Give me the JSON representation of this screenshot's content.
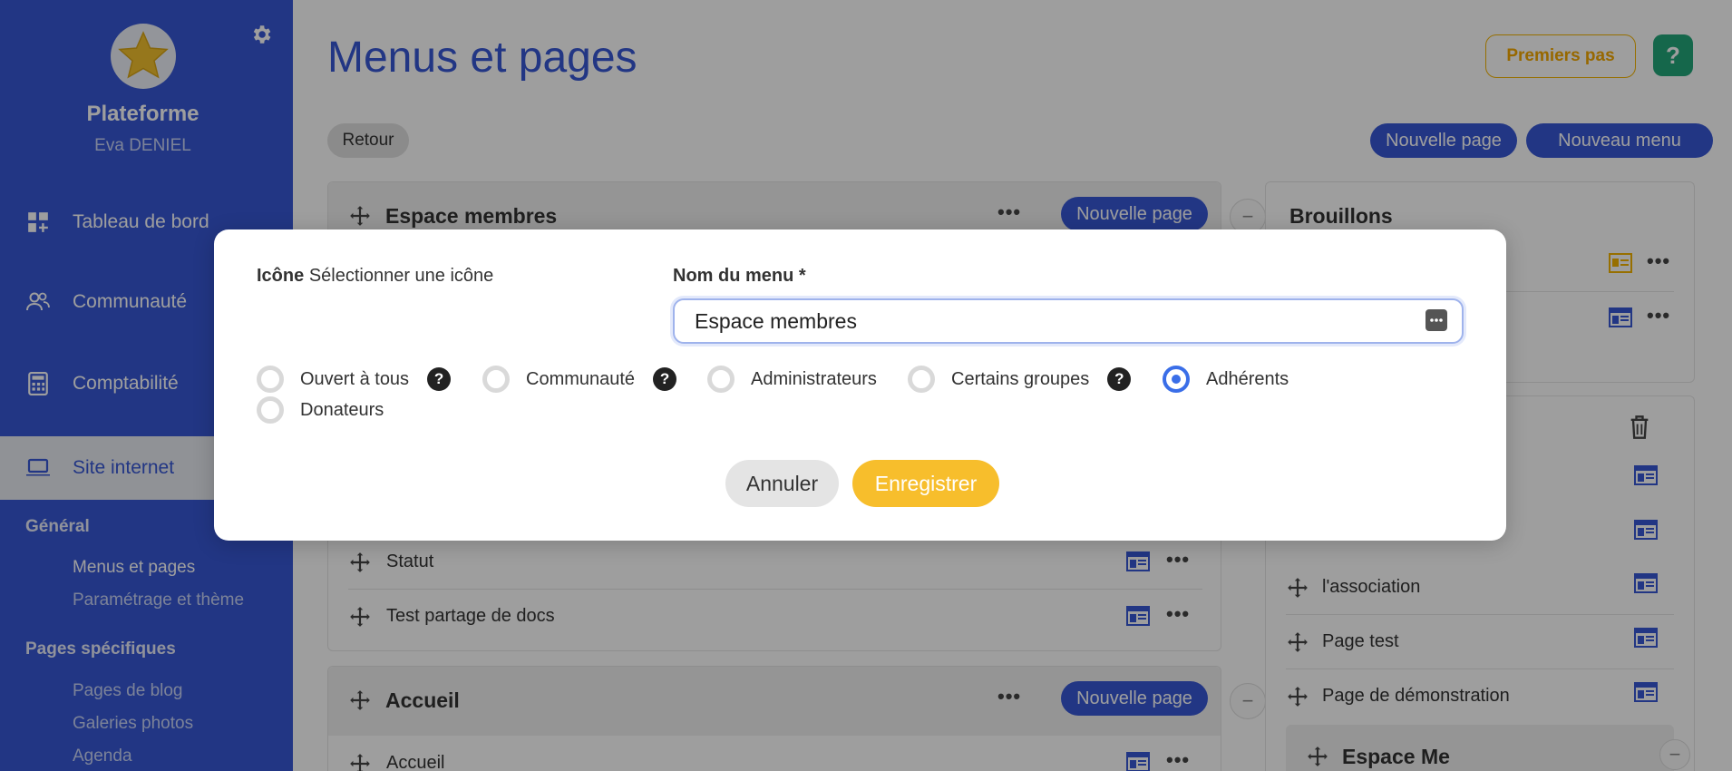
{
  "sidebar": {
    "platform": "Plateforme",
    "user": "Eva DENIEL",
    "nav": [
      "Tableau de bord",
      "Communauté",
      "Comptabilité",
      "Site internet"
    ],
    "section_general": "Général",
    "general_items": [
      "Menus et pages",
      "Paramétrage et thème"
    ],
    "section_specific": "Pages spécifiques",
    "specific_items": [
      "Pages de blog",
      "Galeries photos",
      "Agenda"
    ]
  },
  "header": {
    "title": "Menus et pages",
    "first_steps": "Premiers pas",
    "help": "?",
    "back": "Retour",
    "new_page": "Nouvelle page",
    "new_menu": "Nouveau menu"
  },
  "menu_espace": {
    "title": "Espace membres",
    "new_page": "Nouvelle page",
    "rows": [
      "Statut",
      "Test partage de docs"
    ]
  },
  "menu_accueil": {
    "title": "Accueil",
    "new_page": "Nouvelle page",
    "rows": [
      "Accueil"
    ]
  },
  "drafts": {
    "title": "Brouillons"
  },
  "right_list": {
    "rows": [
      "l'association",
      "Page test",
      "Page de démonstration"
    ],
    "bottom_title": "Espace Me"
  },
  "modal": {
    "icon_label": "Icône",
    "icon_select": "Sélectionner une icône",
    "menu_name_label": "Nom du menu *",
    "menu_name_value": "Espace membres",
    "options": [
      {
        "label": "Ouvert à tous",
        "help": true,
        "checked": false
      },
      {
        "label": "Communauté",
        "help": true,
        "checked": false
      },
      {
        "label": "Administrateurs",
        "help": false,
        "checked": false
      },
      {
        "label": "Certains groupes",
        "help": true,
        "checked": false
      },
      {
        "label": "Adhérents",
        "help": false,
        "checked": true
      },
      {
        "label": "Donateurs",
        "help": false,
        "checked": false
      }
    ],
    "cancel": "Annuler",
    "save": "Enregistrer"
  }
}
